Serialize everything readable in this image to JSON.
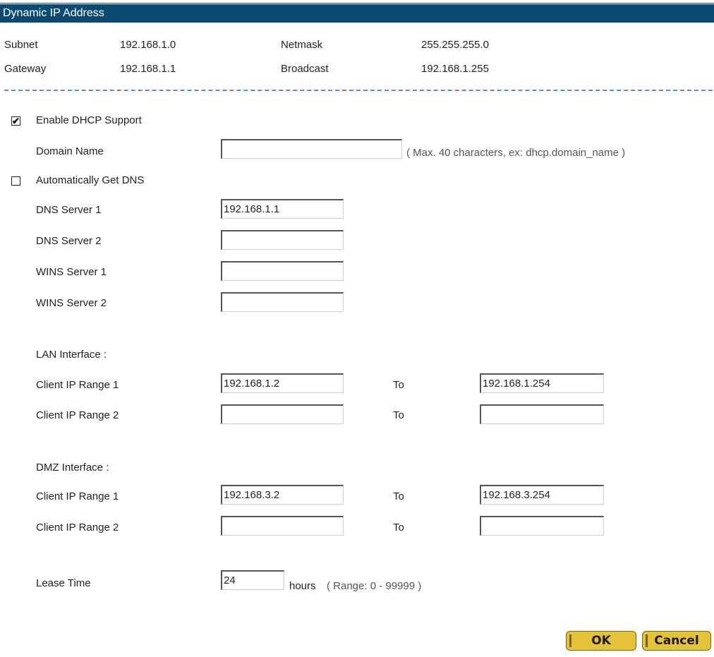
{
  "header": {
    "title": "Dynamic IP Address"
  },
  "info": {
    "subnet_label": "Subnet",
    "subnet_value": "192.168.1.0",
    "netmask_label": "Netmask",
    "netmask_value": "255.255.255.0",
    "gateway_label": "Gateway",
    "gateway_value": "192.168.1.1",
    "broadcast_label": "Broadcast",
    "broadcast_value": "192.168.1.255"
  },
  "dhcp": {
    "enable_label": "Enable DHCP Support",
    "enable_checked": true,
    "domain_label": "Domain Name",
    "domain_value": "",
    "domain_hint": "( Max. 40 characters, ex: dhcp.domain_name )",
    "auto_dns_label": "Automatically Get DNS",
    "auto_dns_checked": false,
    "dns1_label": "DNS Server 1",
    "dns1_value": "192.168.1.1",
    "dns2_label": "DNS Server 2",
    "dns2_value": "",
    "wins1_label": "WINS Server 1",
    "wins1_value": "",
    "wins2_label": "WINS Server 2",
    "wins2_value": ""
  },
  "lan": {
    "title": "LAN Interface :",
    "range1_label": "Client IP Range 1",
    "range1_from": "192.168.1.2",
    "range1_to_label": "To",
    "range1_to": "192.168.1.254",
    "range2_label": "Client IP Range 2",
    "range2_from": "",
    "range2_to_label": "To",
    "range2_to": ""
  },
  "dmz": {
    "title": "DMZ Interface :",
    "range1_label": "Client IP Range 1",
    "range1_from": "192.168.3.2",
    "range1_to_label": "To",
    "range1_to": "192.168.3.254",
    "range2_label": "Client IP Range 2",
    "range2_from": "",
    "range2_to_label": "To",
    "range2_to": ""
  },
  "lease": {
    "label": "Lease Time",
    "value": "24",
    "unit": "hours",
    "hint": "( Range: 0 - 99999 )"
  },
  "buttons": {
    "ok": "OK",
    "cancel": "Cancel"
  },
  "colors": {
    "header_bg": "#0d4a73",
    "divider": "#5b8db5",
    "button_bg": "#e4c23a"
  },
  "icons": {
    "checked": "check-mark",
    "unchecked": "empty-box"
  }
}
